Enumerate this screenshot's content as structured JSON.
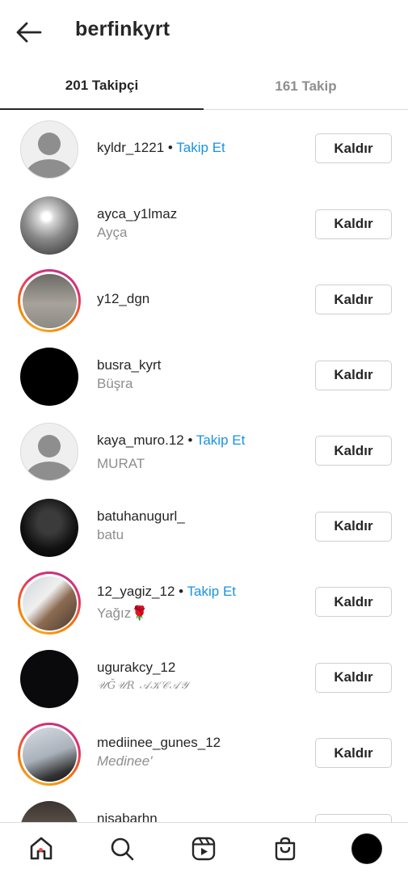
{
  "header": {
    "title": "berfinkyrt",
    "back_icon": "arrow-left-icon"
  },
  "tabs": [
    {
      "label": "201 Takipçi",
      "active": true
    },
    {
      "label": "161 Takip",
      "active": false
    }
  ],
  "remove_label": "Kaldır",
  "follow_label": "Takip Et",
  "followers": [
    {
      "username": "kyldr_1221",
      "name": "",
      "show_follow": true
    },
    {
      "username": "ayca_y1lmaz",
      "name": "Ayça",
      "show_follow": false
    },
    {
      "username": "y12_dgn",
      "name": "",
      "show_follow": false
    },
    {
      "username": "busra_kyrt",
      "name": "Büşra",
      "show_follow": false
    },
    {
      "username": "kaya_muro.12",
      "name": "MURAT",
      "show_follow": true
    },
    {
      "username": "batuhanugurl_",
      "name": "batu",
      "show_follow": false
    },
    {
      "username": "12_yagiz_12",
      "name": "Yağız🌹",
      "show_follow": true
    },
    {
      "username": "ugurakcy_12",
      "name": "𝒰Ğ𝒰𝑅 𝒜𝒦𝒞𝒜𝒴",
      "show_follow": false
    },
    {
      "username": "mediinee_gunes_12",
      "name": "Medinee'",
      "show_follow": false
    },
    {
      "username": "nisabarhn",
      "name": "",
      "show_follow": false
    }
  ],
  "bottom_nav": [
    "home-icon",
    "search-icon",
    "reels-icon",
    "shop-icon",
    "profile-avatar"
  ],
  "colors": {
    "link": "#1a93e0",
    "notification": "#ed4956"
  }
}
